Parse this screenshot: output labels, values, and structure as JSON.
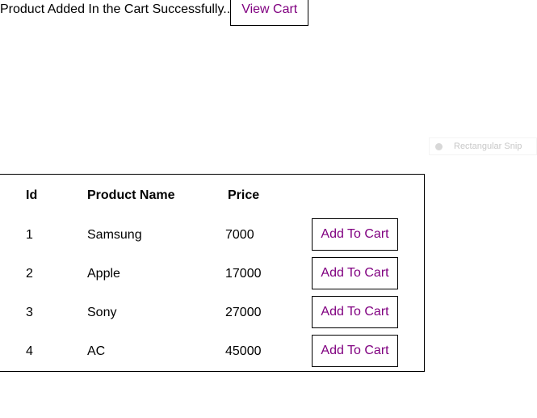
{
  "notice": {
    "message": "Product Added In the Cart Successfully..",
    "view_cart_label": "View Cart"
  },
  "snip_tooltip": {
    "icon": "snip-icon",
    "label": "Rectangular Snip"
  },
  "table": {
    "headers": [
      "Id",
      "Product Name",
      "Price"
    ],
    "rows": [
      {
        "id": "1",
        "name": "Samsung",
        "price": "7000",
        "button": "Add To Cart"
      },
      {
        "id": "2",
        "name": "Apple",
        "price": "17000",
        "button": "Add To Cart"
      },
      {
        "id": "3",
        "name": "Sony",
        "price": "27000",
        "button": "Add To Cart"
      },
      {
        "id": "4",
        "name": "AC",
        "price": "45000",
        "button": "Add To Cart"
      }
    ]
  },
  "colors": {
    "link": "#800080",
    "border": "#000000"
  }
}
